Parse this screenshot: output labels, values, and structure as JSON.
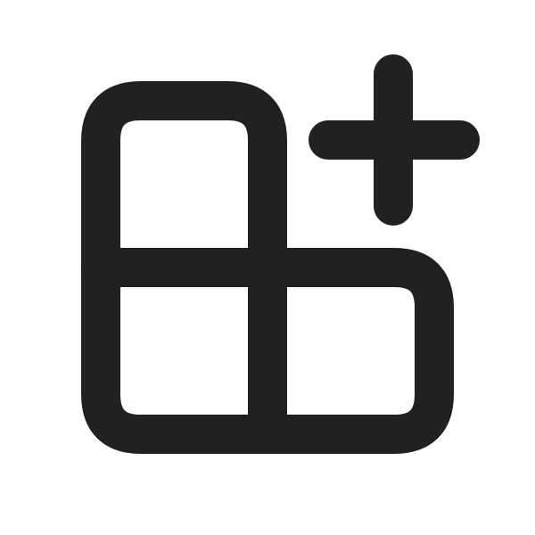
{
  "icon": {
    "name": "add-grid-icon",
    "stroke_color": "#212121",
    "background_color": "#ffffff"
  }
}
